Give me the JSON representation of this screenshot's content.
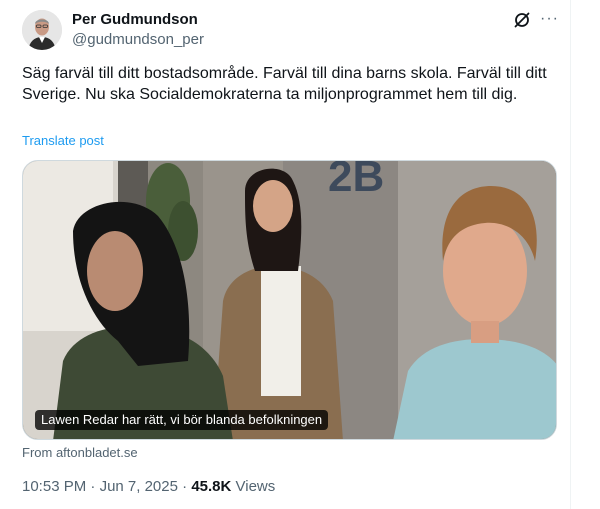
{
  "author": {
    "display_name": "Per Gudmundson",
    "handle": "@gudmundson_per"
  },
  "header_icons": {
    "grok": "grok-slashed-circle-icon",
    "more": "more-horizontal-icon",
    "more_glyph": "···"
  },
  "post": {
    "text": "Säg farväl till ditt bostadsområde. Farväl till dina barns skola. Farväl till ditt Sverige. Nu ska Socialdemokraterna ta miljonprogrammet hem till dig.",
    "translate_label": "Translate post"
  },
  "media": {
    "caption": "Lawen Redar har rätt, vi bör blanda befolkningen",
    "sign_text": "2B",
    "source_label": "From aftonbladet.se"
  },
  "meta": {
    "time": "10:53 PM",
    "separator": "·",
    "date": "Jun 7, 2025",
    "views_count": "45.8K",
    "views_label": "Views"
  },
  "colors": {
    "text": "#0f1419",
    "secondary": "#536471",
    "link": "#1d9bf0",
    "border": "#cfd9de"
  }
}
